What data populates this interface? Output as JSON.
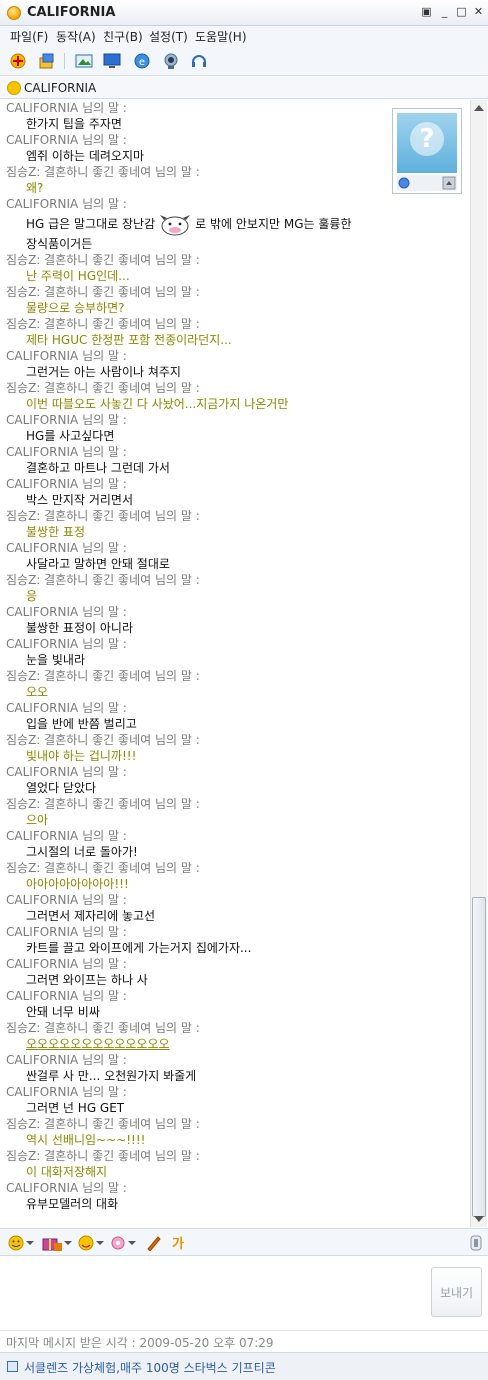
{
  "window": {
    "title": "CALIFORNIA"
  },
  "menu": [
    "파일(F)",
    "동작(A)",
    "친구(B)",
    "설정(T)",
    "도움말(H)"
  ],
  "contact": {
    "name": "CALIFORNIA"
  },
  "chat": {
    "speaker_suffix": "님의 말 :",
    "messages": [
      {
        "who": "CALIFORNIA",
        "kind": "me",
        "text": "한가지 팁을 주자면"
      },
      {
        "who": "CALIFORNIA",
        "kind": "me",
        "text": "엠쥐 이하는 데려오지마"
      },
      {
        "who": "짐승Z: 결혼하니 좋긴 좋네여",
        "kind": "other",
        "text": "왜?"
      },
      {
        "who": "CALIFORNIA",
        "kind": "me",
        "text": "HG 급은 말그대로 장난감",
        "text2": "로 밖에 안보지만 MG는 훌륭한",
        "cont": "장식품이거든"
      },
      {
        "who": "짐승Z: 결혼하니 좋긴 좋네여",
        "kind": "other",
        "text": "난 주력이 HG인데..."
      },
      {
        "who": "짐승Z: 결혼하니 좋긴 좋네여",
        "kind": "other",
        "text": "물량으로 승부하면?"
      },
      {
        "who": "짐승Z: 결혼하니 좋긴 좋네여",
        "kind": "other",
        "text": "제타 HGUC 한정판 포함 전종이라던지..."
      },
      {
        "who": "CALIFORNIA",
        "kind": "me",
        "text": "그런거는 아는 사람이나 쳐주지"
      },
      {
        "who": "짐승Z: 결혼하니 좋긴 좋네여",
        "kind": "other",
        "text": "이번 따블오도 사놓긴 다 사놨어...지금가지 나온거만"
      },
      {
        "who": "CALIFORNIA",
        "kind": "me",
        "text": "HG를 사고싶다면"
      },
      {
        "who": "CALIFORNIA",
        "kind": "me",
        "text": "결혼하고 마트나 그런데 가서"
      },
      {
        "who": "CALIFORNIA",
        "kind": "me",
        "text": "박스 만지작 거리면서"
      },
      {
        "who": "짐승Z: 결혼하니 좋긴 좋네여",
        "kind": "other",
        "text": "불쌍한 표정"
      },
      {
        "who": "CALIFORNIA",
        "kind": "me",
        "text": "사달라고 말하면 안돼 절대로"
      },
      {
        "who": "짐승Z: 결혼하니 좋긴 좋네여",
        "kind": "other",
        "text": "응"
      },
      {
        "who": "CALIFORNIA",
        "kind": "me",
        "text": "불쌍한 표정이 아니라"
      },
      {
        "who": "CALIFORNIA",
        "kind": "me",
        "text": "눈을 빛내라"
      },
      {
        "who": "짐승Z: 결혼하니 좋긴 좋네여",
        "kind": "other",
        "text": "오오"
      },
      {
        "who": "CALIFORNIA",
        "kind": "me",
        "text": "입을 반에 반쯤 벌리고"
      },
      {
        "who": "짐승Z: 결혼하니 좋긴 좋네여",
        "kind": "other",
        "text": "빛내야 하는 겁니까!!!"
      },
      {
        "who": "CALIFORNIA",
        "kind": "me",
        "text": "열었다 닫았다"
      },
      {
        "who": "짐승Z: 결혼하니 좋긴 좋네여",
        "kind": "other",
        "text": "으아"
      },
      {
        "who": "CALIFORNIA",
        "kind": "me",
        "text": "그시절의 너로 돌아가!"
      },
      {
        "who": "짐승Z: 결혼하니 좋긴 좋네여",
        "kind": "other",
        "text": "아아아아아아아아!!!"
      },
      {
        "who": "CALIFORNIA",
        "kind": "me",
        "text": "그러면서 제자리에 놓고선"
      },
      {
        "who": "CALIFORNIA",
        "kind": "me",
        "text": "카트를 끌고 와이프에게 가는거지 집에가자..."
      },
      {
        "who": "CALIFORNIA",
        "kind": "me",
        "text": "그러면 와이프는 하나 사"
      },
      {
        "who": "CALIFORNIA",
        "kind": "me",
        "text": "안돼 너무 비싸"
      },
      {
        "who": "짐승Z: 결혼하니 좋긴 좋네여",
        "kind": "other",
        "text": "오오오오오오오오오오오오오",
        "underline": true
      },
      {
        "who": "CALIFORNIA",
        "kind": "me",
        "text": "싼걸루 사 만... 오천원가지 봐줄게"
      },
      {
        "who": "CALIFORNIA",
        "kind": "me",
        "text": "그러면 넌 HG GET"
      },
      {
        "who": "짐승Z: 결혼하니 좋긴 좋네여",
        "kind": "other",
        "text": "역시 선배니임~~~!!!!"
      },
      {
        "who": "짐승Z: 결혼하니 좋긴 좋네여",
        "kind": "other",
        "text": "이 대화저장해지"
      },
      {
        "who": "CALIFORNIA",
        "kind": "me",
        "text": "유부모델러의 대화"
      }
    ]
  },
  "send": {
    "label": "보내기"
  },
  "status": {
    "text": "마지막 메시지 받은 시각 : 2009-05-20 오후 07:29"
  },
  "ad": {
    "text": "서클렌즈 가상체험,매주 100명 스타벅스 기프티콘"
  },
  "colors": {
    "me": "#111111",
    "other": "#8a8a00",
    "speaker": "#7b7b7b",
    "ad_link": "#2a5ca8"
  }
}
